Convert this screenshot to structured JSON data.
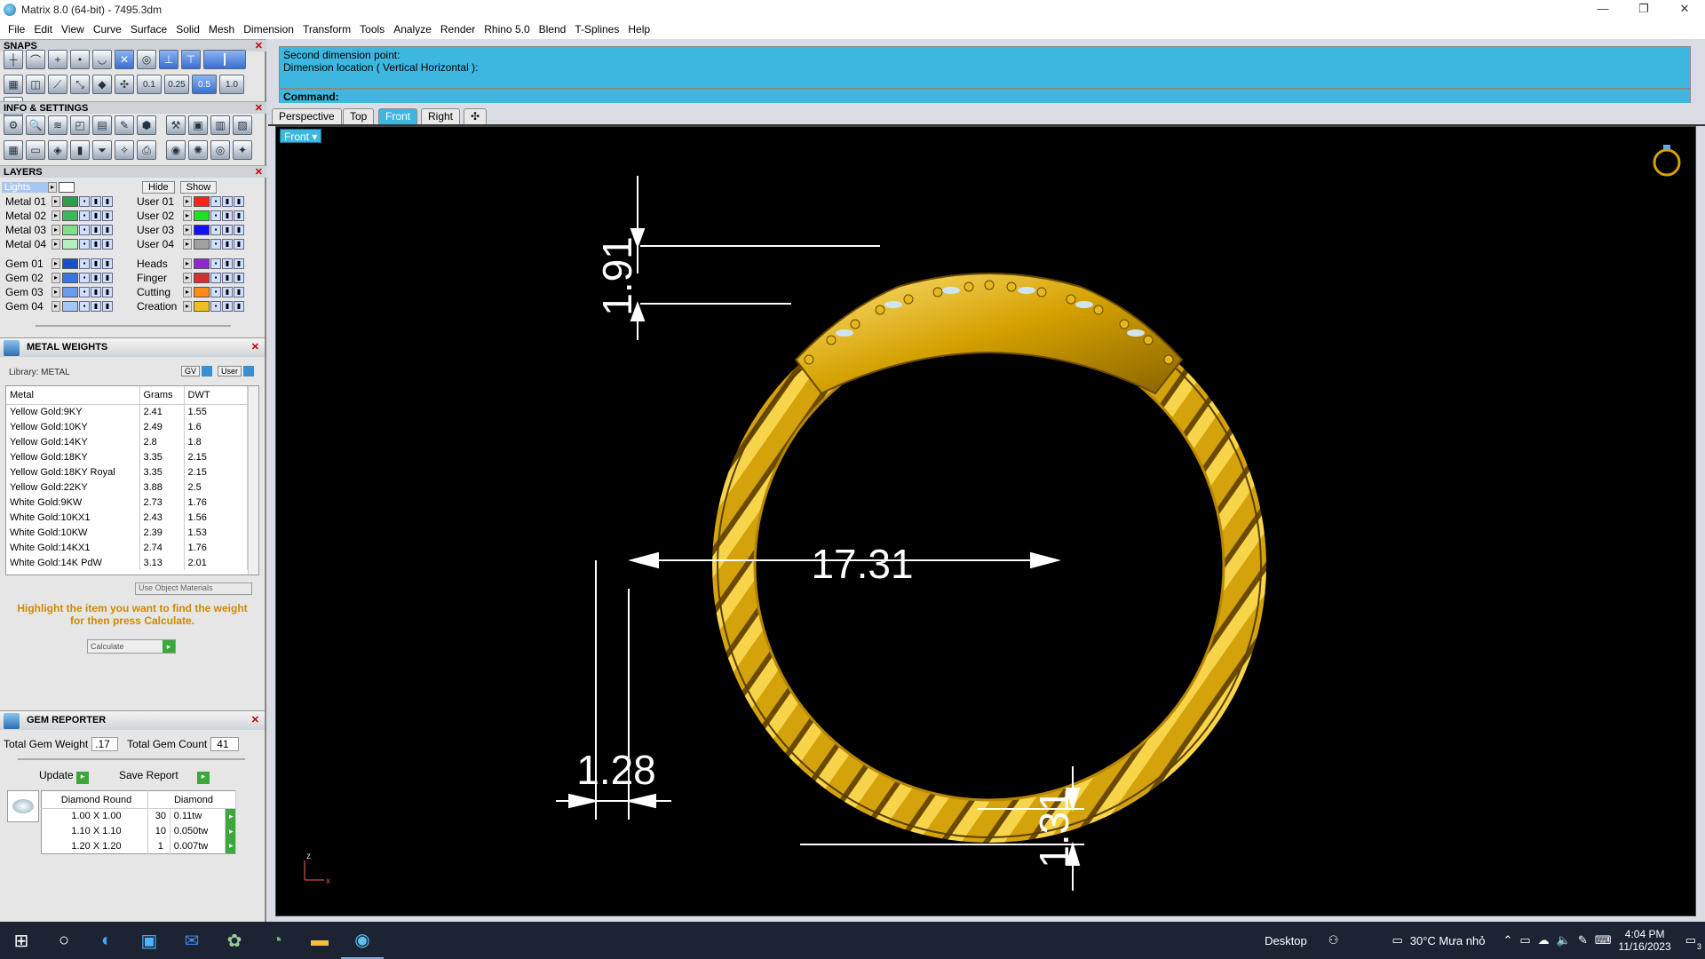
{
  "window": {
    "title": "Matrix 8.0 (64-bit) - 7495.3dm",
    "controls": [
      "—",
      "❐",
      "✕"
    ]
  },
  "menu": [
    "File",
    "Edit",
    "View",
    "Curve",
    "Surface",
    "Solid",
    "Mesh",
    "Dimension",
    "Transform",
    "Tools",
    "Analyze",
    "Render",
    "Rhino 5.0",
    "Blend",
    "T-Splines",
    "Help"
  ],
  "snaps": {
    "header": "SNAPS",
    "values": [
      "0.1",
      "0.25",
      "0.5",
      "1.0"
    ]
  },
  "info_settings": {
    "header": "INFO & SETTINGS"
  },
  "layers": {
    "header": "LAYERS",
    "lights_label": "Lights",
    "hide_label": "Hide",
    "show_label": "Show",
    "left": [
      {
        "name": "Metal 01",
        "color": "#2aa04a"
      },
      {
        "name": "Metal 02",
        "color": "#3cb85c"
      },
      {
        "name": "Metal 03",
        "color": "#7fe08a"
      },
      {
        "name": "Metal 04",
        "color": "#b5f0bc"
      },
      {
        "name": "Gem 01",
        "color": "#1a4fc8"
      },
      {
        "name": "Gem 02",
        "color": "#3b73e0"
      },
      {
        "name": "Gem 03",
        "color": "#6b9bf0"
      },
      {
        "name": "Gem 04",
        "color": "#a5c4f8"
      }
    ],
    "right": [
      {
        "name": "User 01",
        "color": "#ff2020"
      },
      {
        "name": "User 02",
        "color": "#20e020"
      },
      {
        "name": "User 03",
        "color": "#1010ff"
      },
      {
        "name": "User 04",
        "color": "#a0a0a0"
      },
      {
        "name": "Heads",
        "color": "#8a2ad0"
      },
      {
        "name": "Finger",
        "color": "#d03030"
      },
      {
        "name": "Cutting",
        "color": "#ff8c1a"
      },
      {
        "name": "Creation",
        "color": "#f0c020"
      }
    ]
  },
  "metal_weights": {
    "header": "METAL WEIGHTS",
    "library": "Library: METAL",
    "gv_label": "GV",
    "user_label": "User",
    "columns": [
      "Metal",
      "Grams",
      "DWT"
    ],
    "rows": [
      [
        "Yellow Gold:9KY",
        "2.41",
        "1.55"
      ],
      [
        "Yellow Gold:10KY",
        "2.49",
        "1.6"
      ],
      [
        "Yellow Gold:14KY",
        "2.8",
        "1.8"
      ],
      [
        "Yellow Gold:18KY",
        "3.35",
        "2.15"
      ],
      [
        "Yellow Gold:18KY Royal",
        "3.35",
        "2.15"
      ],
      [
        "Yellow Gold:22KY",
        "3.88",
        "2.5"
      ],
      [
        "White Gold:9KW",
        "2.73",
        "1.76"
      ],
      [
        "White Gold:10KX1",
        "2.43",
        "1.56"
      ],
      [
        "White Gold:10KW",
        "2.39",
        "1.53"
      ],
      [
        "White Gold:14KX1",
        "2.74",
        "1.76"
      ],
      [
        "White Gold:14K PdW",
        "3.13",
        "2.01"
      ]
    ],
    "use_object_materials": "Use Object Materials",
    "hint": "Highlight the item you want to find the weight for then press Calculate.",
    "calculate": "Calculate"
  },
  "gem_reporter": {
    "header": "GEM REPORTER",
    "total_weight_label": "Total Gem Weight",
    "total_weight": ".17",
    "total_count_label": "Total Gem Count",
    "total_count": "41",
    "update": "Update",
    "save_report": "Save Report",
    "columns": [
      "Diamond Round",
      "Diamond"
    ],
    "rows": [
      [
        "1.00 X 1.00",
        "30",
        "0.11tw"
      ],
      [
        "1.10 X 1.10",
        "10",
        "0.050tw"
      ],
      [
        "1.20 X 1.20",
        "1",
        "0.007tw"
      ]
    ]
  },
  "command": {
    "history": [
      "Second dimension point:",
      "Dimension location ( Vertical  Horizontal ):"
    ],
    "prompt": "Command:"
  },
  "viewport_tabs": [
    "Perspective",
    "Top",
    "Front",
    "Right"
  ],
  "active_tab": "Front",
  "viewport_label": "Front",
  "dimensions": {
    "diameter": "17.31",
    "top": "1.91",
    "left": "1.28",
    "right": "1.31"
  },
  "axis": {
    "z": "z",
    "x": "x"
  },
  "taskbar": {
    "desktop": "Desktop",
    "weather": "30°C  Mưa nhỏ",
    "time": "4:04 PM",
    "date": "11/16/2023",
    "notif": "3"
  }
}
